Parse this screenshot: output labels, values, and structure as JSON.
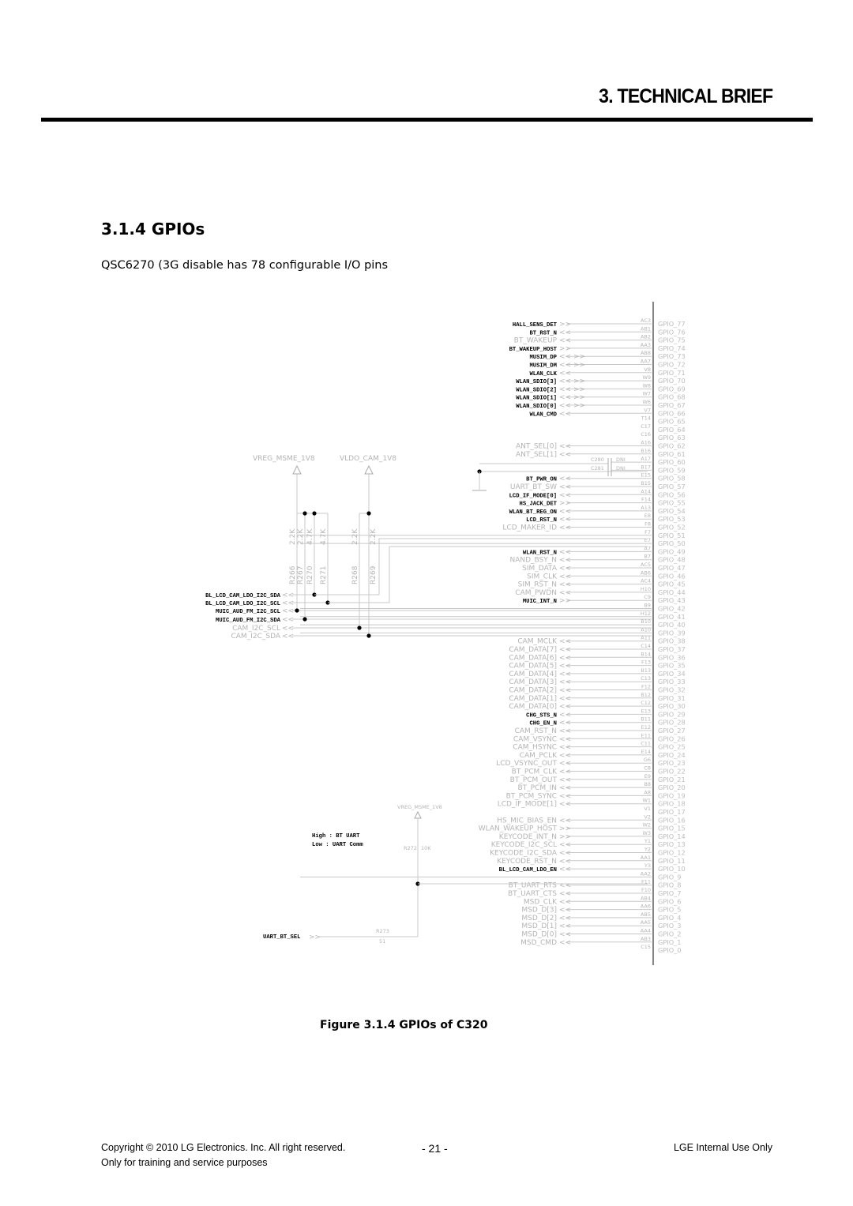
{
  "header": {
    "chapter_title": "3. TECHNICAL BRIEF"
  },
  "section": {
    "title": "3.1.4 GPIOs",
    "description": "QSC6270 (3G disable  has 78 configurable I/O pins"
  },
  "schematic": {
    "power_rails": [
      "VREG_MSME_1V8",
      "VLDO_CAM_1V8",
      "VREG_MSME_1V8"
    ],
    "resistors": [
      {
        "ref": "R266",
        "value": "2.2K"
      },
      {
        "ref": "R267",
        "value": "2.2K"
      },
      {
        "ref": "R270",
        "value": "4.7K"
      },
      {
        "ref": "R271",
        "value": "4.7K"
      },
      {
        "ref": "R268",
        "value": "2.2K"
      },
      {
        "ref": "R269",
        "value": "2.2K"
      },
      {
        "ref": "R272",
        "value": "10K"
      },
      {
        "ref": "R273",
        "value": "51"
      }
    ],
    "capacitors": [
      {
        "ref": "C280",
        "value": "DNI"
      },
      {
        "ref": "C281",
        "value": "DNI"
      }
    ],
    "i2c_nets": [
      {
        "name": "BL_LCD_CAM_LDO_I2C_SDA",
        "emphasis": "bold"
      },
      {
        "name": "BL_LCD_CAM_LDO_I2C_SCL",
        "emphasis": "bold"
      },
      {
        "name": "MUIC_AUD_FM_I2C_SCL",
        "emphasis": "bold"
      },
      {
        "name": "MUIC_AUD_FM_I2C_SDA",
        "emphasis": "bold"
      },
      {
        "name": "CAM_I2C_SCL",
        "emphasis": "gray"
      },
      {
        "name": "CAM_I2C_SDA",
        "emphasis": "gray"
      }
    ],
    "uart_note": [
      "High : BT UART",
      "Low : UART Comm"
    ],
    "uart_sel_net": "UART_BT_SEL",
    "pins": [
      {
        "gpio": "GPIO_77",
        "ball": "AC3",
        "net": "HALL_SENS_DET",
        "emphasis": "bold",
        "dir": "in"
      },
      {
        "gpio": "GPIO_76",
        "ball": "AB1",
        "net": "BT_RST_N",
        "emphasis": "bold",
        "dir": "out"
      },
      {
        "gpio": "GPIO_75",
        "ball": "AB2",
        "net": "BT_WAKEUP",
        "emphasis": "gray",
        "dir": "out"
      },
      {
        "gpio": "GPIO_74",
        "ball": "AA3",
        "net": "BT_WAKEUP_HOST",
        "emphasis": "bold",
        "dir": "in"
      },
      {
        "gpio": "GPIO_73",
        "ball": "AB8",
        "net": "MUSIM_DP",
        "emphasis": "bold",
        "dir": "bi"
      },
      {
        "gpio": "GPIO_72",
        "ball": "AA7",
        "net": "MUSIM_DM",
        "emphasis": "bold",
        "dir": "bi"
      },
      {
        "gpio": "GPIO_71",
        "ball": "V8",
        "net": "WLAN_CLK",
        "emphasis": "bold",
        "dir": "out"
      },
      {
        "gpio": "GPIO_70",
        "ball": "W9",
        "net": "WLAN_SDIO[3]",
        "emphasis": "bold",
        "dir": "bi"
      },
      {
        "gpio": "GPIO_69",
        "ball": "W8",
        "net": "WLAN_SDIO[2]",
        "emphasis": "bold",
        "dir": "bi"
      },
      {
        "gpio": "GPIO_68",
        "ball": "W7",
        "net": "WLAN_SDIO[1]",
        "emphasis": "bold",
        "dir": "bi"
      },
      {
        "gpio": "GPIO_67",
        "ball": "W6",
        "net": "WLAN_SDIO[0]",
        "emphasis": "bold",
        "dir": "bi"
      },
      {
        "gpio": "GPIO_66",
        "ball": "V7",
        "net": "WLAN_CMD",
        "emphasis": "bold",
        "dir": "out"
      },
      {
        "gpio": "GPIO_65",
        "ball": "T14",
        "net": "",
        "emphasis": "none",
        "dir": ""
      },
      {
        "gpio": "GPIO_64",
        "ball": "C17",
        "net": "",
        "emphasis": "none",
        "dir": ""
      },
      {
        "gpio": "GPIO_63",
        "ball": "C16",
        "net": "",
        "emphasis": "none",
        "dir": ""
      },
      {
        "gpio": "GPIO_62",
        "ball": "A16",
        "net": "ANT_SEL[0]",
        "emphasis": "gray",
        "dir": "out"
      },
      {
        "gpio": "GPIO_61",
        "ball": "B16",
        "net": "ANT_SEL[1]",
        "emphasis": "gray",
        "dir": "out"
      },
      {
        "gpio": "GPIO_60",
        "ball": "A17",
        "net": "C280 DNI",
        "emphasis": "cap",
        "dir": ""
      },
      {
        "gpio": "GPIO_59",
        "ball": "B17",
        "net": "C281 DNI",
        "emphasis": "cap",
        "dir": ""
      },
      {
        "gpio": "GPIO_58",
        "ball": "E15",
        "net": "BT_PWR_ON",
        "emphasis": "bold",
        "dir": "out"
      },
      {
        "gpio": "GPIO_57",
        "ball": "B15",
        "net": "UART_BT_SW",
        "emphasis": "gray",
        "dir": "out"
      },
      {
        "gpio": "GPIO_56",
        "ball": "A14",
        "net": "LCD_IF_MODE[0]",
        "emphasis": "bold",
        "dir": "out"
      },
      {
        "gpio": "GPIO_55",
        "ball": "F14",
        "net": "HS_JACK_DET",
        "emphasis": "bold",
        "dir": "in"
      },
      {
        "gpio": "GPIO_54",
        "ball": "A13",
        "net": "WLAN_BT_REG_ON",
        "emphasis": "bold",
        "dir": "out"
      },
      {
        "gpio": "GPIO_53",
        "ball": "E8",
        "net": "LCD_RST_N",
        "emphasis": "bold",
        "dir": "out"
      },
      {
        "gpio": "GPIO_52",
        "ball": "F8",
        "net": "LCD_MAKER_ID",
        "emphasis": "gray",
        "dir": "out"
      },
      {
        "gpio": "GPIO_51",
        "ball": "F7",
        "net": "",
        "emphasis": "wire",
        "dir": ""
      },
      {
        "gpio": "GPIO_50",
        "ball": "E7",
        "net": "",
        "emphasis": "wire",
        "dir": ""
      },
      {
        "gpio": "GPIO_49",
        "ball": "A7",
        "net": "WLAN_RST_N",
        "emphasis": "bold",
        "dir": "out"
      },
      {
        "gpio": "GPIO_48",
        "ball": "B7",
        "net": "NAND_BSY_N",
        "emphasis": "gray",
        "dir": "out"
      },
      {
        "gpio": "GPIO_47",
        "ball": "AC5",
        "net": "SIM_DATA",
        "emphasis": "gray",
        "dir": "out"
      },
      {
        "gpio": "GPIO_46",
        "ball": "AB6",
        "net": "SIM_CLK",
        "emphasis": "gray",
        "dir": "out"
      },
      {
        "gpio": "GPIO_45",
        "ball": "AC4",
        "net": "SIM_RST_N",
        "emphasis": "gray",
        "dir": "out"
      },
      {
        "gpio": "GPIO_44",
        "ball": "H10",
        "net": "CAM_PWDN",
        "emphasis": "gray",
        "dir": "out"
      },
      {
        "gpio": "GPIO_43",
        "ball": "C9",
        "net": "MUIC_INT_N",
        "emphasis": "bold",
        "dir": "in"
      },
      {
        "gpio": "GPIO_42",
        "ball": "B9",
        "net": "",
        "emphasis": "wire",
        "dir": ""
      },
      {
        "gpio": "GPIO_41",
        "ball": "H12",
        "net": "",
        "emphasis": "wire",
        "dir": ""
      },
      {
        "gpio": "GPIO_40",
        "ball": "B10",
        "net": "",
        "emphasis": "wire",
        "dir": ""
      },
      {
        "gpio": "GPIO_39",
        "ball": "A10",
        "net": "",
        "emphasis": "wire",
        "dir": ""
      },
      {
        "gpio": "GPIO_38",
        "ball": "A11",
        "net": "CAM_MCLK",
        "emphasis": "gray",
        "dir": "out"
      },
      {
        "gpio": "GPIO_37",
        "ball": "C14",
        "net": "CAM_DATA[7]",
        "emphasis": "gray",
        "dir": "out"
      },
      {
        "gpio": "GPIO_36",
        "ball": "B14",
        "net": "CAM_DATA[6]",
        "emphasis": "gray",
        "dir": "out"
      },
      {
        "gpio": "GPIO_35",
        "ball": "F13",
        "net": "CAM_DATA[5]",
        "emphasis": "gray",
        "dir": "out"
      },
      {
        "gpio": "GPIO_34",
        "ball": "B13",
        "net": "CAM_DATA[4]",
        "emphasis": "gray",
        "dir": "out"
      },
      {
        "gpio": "GPIO_33",
        "ball": "C13",
        "net": "CAM_DATA[3]",
        "emphasis": "gray",
        "dir": "out"
      },
      {
        "gpio": "GPIO_32",
        "ball": "F12",
        "net": "CAM_DATA[2]",
        "emphasis": "gray",
        "dir": "out"
      },
      {
        "gpio": "GPIO_31",
        "ball": "B12",
        "net": "CAM_DATA[1]",
        "emphasis": "gray",
        "dir": "out"
      },
      {
        "gpio": "GPIO_30",
        "ball": "C12",
        "net": "CAM_DATA[0]",
        "emphasis": "gray",
        "dir": "out"
      },
      {
        "gpio": "GPIO_29",
        "ball": "E13",
        "net": "CHG_STS_N",
        "emphasis": "bold",
        "dir": "out"
      },
      {
        "gpio": "GPIO_28",
        "ball": "B11",
        "net": "CHG_EN_N",
        "emphasis": "bold",
        "dir": "out"
      },
      {
        "gpio": "GPIO_27",
        "ball": "E12",
        "net": "CAM_RST_N",
        "emphasis": "gray",
        "dir": "out"
      },
      {
        "gpio": "GPIO_26",
        "ball": "E11",
        "net": "CAM_VSYNC",
        "emphasis": "gray",
        "dir": "out"
      },
      {
        "gpio": "GPIO_25",
        "ball": "C11",
        "net": "CAM_HSYNC",
        "emphasis": "gray",
        "dir": "out"
      },
      {
        "gpio": "GPIO_24",
        "ball": "E14",
        "net": "CAM_PCLK",
        "emphasis": "gray",
        "dir": "out"
      },
      {
        "gpio": "GPIO_23",
        "ball": "G6",
        "net": "LCD_VSYNC_OUT",
        "emphasis": "gray",
        "dir": "out"
      },
      {
        "gpio": "GPIO_22",
        "ball": "C8",
        "net": "BT_PCM_CLK",
        "emphasis": "gray",
        "dir": "out"
      },
      {
        "gpio": "GPIO_21",
        "ball": "E9",
        "net": "BT_PCM_OUT",
        "emphasis": "gray",
        "dir": "out"
      },
      {
        "gpio": "GPIO_20",
        "ball": "B8",
        "net": "BT_PCM_IN",
        "emphasis": "gray",
        "dir": "out"
      },
      {
        "gpio": "GPIO_19",
        "ball": "A8",
        "net": "BT_PCM_SYNC",
        "emphasis": "gray",
        "dir": "out"
      },
      {
        "gpio": "GPIO_18",
        "ball": "W1",
        "net": "LCD_IF_MODE[1]",
        "emphasis": "gray",
        "dir": "out"
      },
      {
        "gpio": "GPIO_17",
        "ball": "V1",
        "net": "",
        "emphasis": "none",
        "dir": ""
      },
      {
        "gpio": "GPIO_16",
        "ball": "V2",
        "net": "HS_MIC_BIAS_EN",
        "emphasis": "gray",
        "dir": "out"
      },
      {
        "gpio": "GPIO_15",
        "ball": "W2",
        "net": "WLAN_WAKEUP_HOST",
        "emphasis": "gray",
        "dir": "in"
      },
      {
        "gpio": "GPIO_14",
        "ball": "W3",
        "net": "KEYCODE_INT_N",
        "emphasis": "gray",
        "dir": "in"
      },
      {
        "gpio": "GPIO_13",
        "ball": "Y1",
        "net": "KEYCODE_I2C_SCL",
        "emphasis": "gray",
        "dir": "out"
      },
      {
        "gpio": "GPIO_12",
        "ball": "Y2",
        "net": "KEYCODE_I2C_SDA",
        "emphasis": "gray",
        "dir": "out"
      },
      {
        "gpio": "GPIO_11",
        "ball": "AA1",
        "net": "KEYCODE_RST_N",
        "emphasis": "gray",
        "dir": "out"
      },
      {
        "gpio": "GPIO_10",
        "ball": "Y3",
        "net": "BL_LCD_CAM_LDO_EN",
        "emphasis": "bold",
        "dir": "out"
      },
      {
        "gpio": "GPIO_9",
        "ball": "AA2",
        "net": "",
        "emphasis": "wire",
        "dir": ""
      },
      {
        "gpio": "GPIO_8",
        "ball": "F11",
        "net": "BT_UART_RTS",
        "emphasis": "gray",
        "dir": "out"
      },
      {
        "gpio": "GPIO_7",
        "ball": "F10",
        "net": "BT_UART_CTS",
        "emphasis": "gray",
        "dir": "out"
      },
      {
        "gpio": "GPIO_6",
        "ball": "AB4",
        "net": "MSD_CLK",
        "emphasis": "gray",
        "dir": "out"
      },
      {
        "gpio": "GPIO_5",
        "ball": "AA6",
        "net": "MSD_D[3]",
        "emphasis": "gray",
        "dir": "out"
      },
      {
        "gpio": "GPIO_4",
        "ball": "AB5",
        "net": "MSD_D[2]",
        "emphasis": "gray",
        "dir": "out"
      },
      {
        "gpio": "GPIO_3",
        "ball": "AA5",
        "net": "MSD_D[1]",
        "emphasis": "gray",
        "dir": "out"
      },
      {
        "gpio": "GPIO_2",
        "ball": "AA4",
        "net": "MSD_D[0]",
        "emphasis": "gray",
        "dir": "out"
      },
      {
        "gpio": "GPIO_1",
        "ball": "AB3",
        "net": "MSD_CMD",
        "emphasis": "gray",
        "dir": "out"
      },
      {
        "gpio": "GPIO_0",
        "ball": "C15",
        "net": "",
        "emphasis": "none",
        "dir": ""
      }
    ]
  },
  "figure": {
    "caption": "Figure 3.1.4 GPIOs of C320"
  },
  "footer": {
    "copyright": "Copyright © 2010 LG Electronics. Inc. All right reserved.",
    "training_note": "Only for training and service purposes",
    "page_number": "- 21 -",
    "classification": "LGE Internal Use Only"
  }
}
